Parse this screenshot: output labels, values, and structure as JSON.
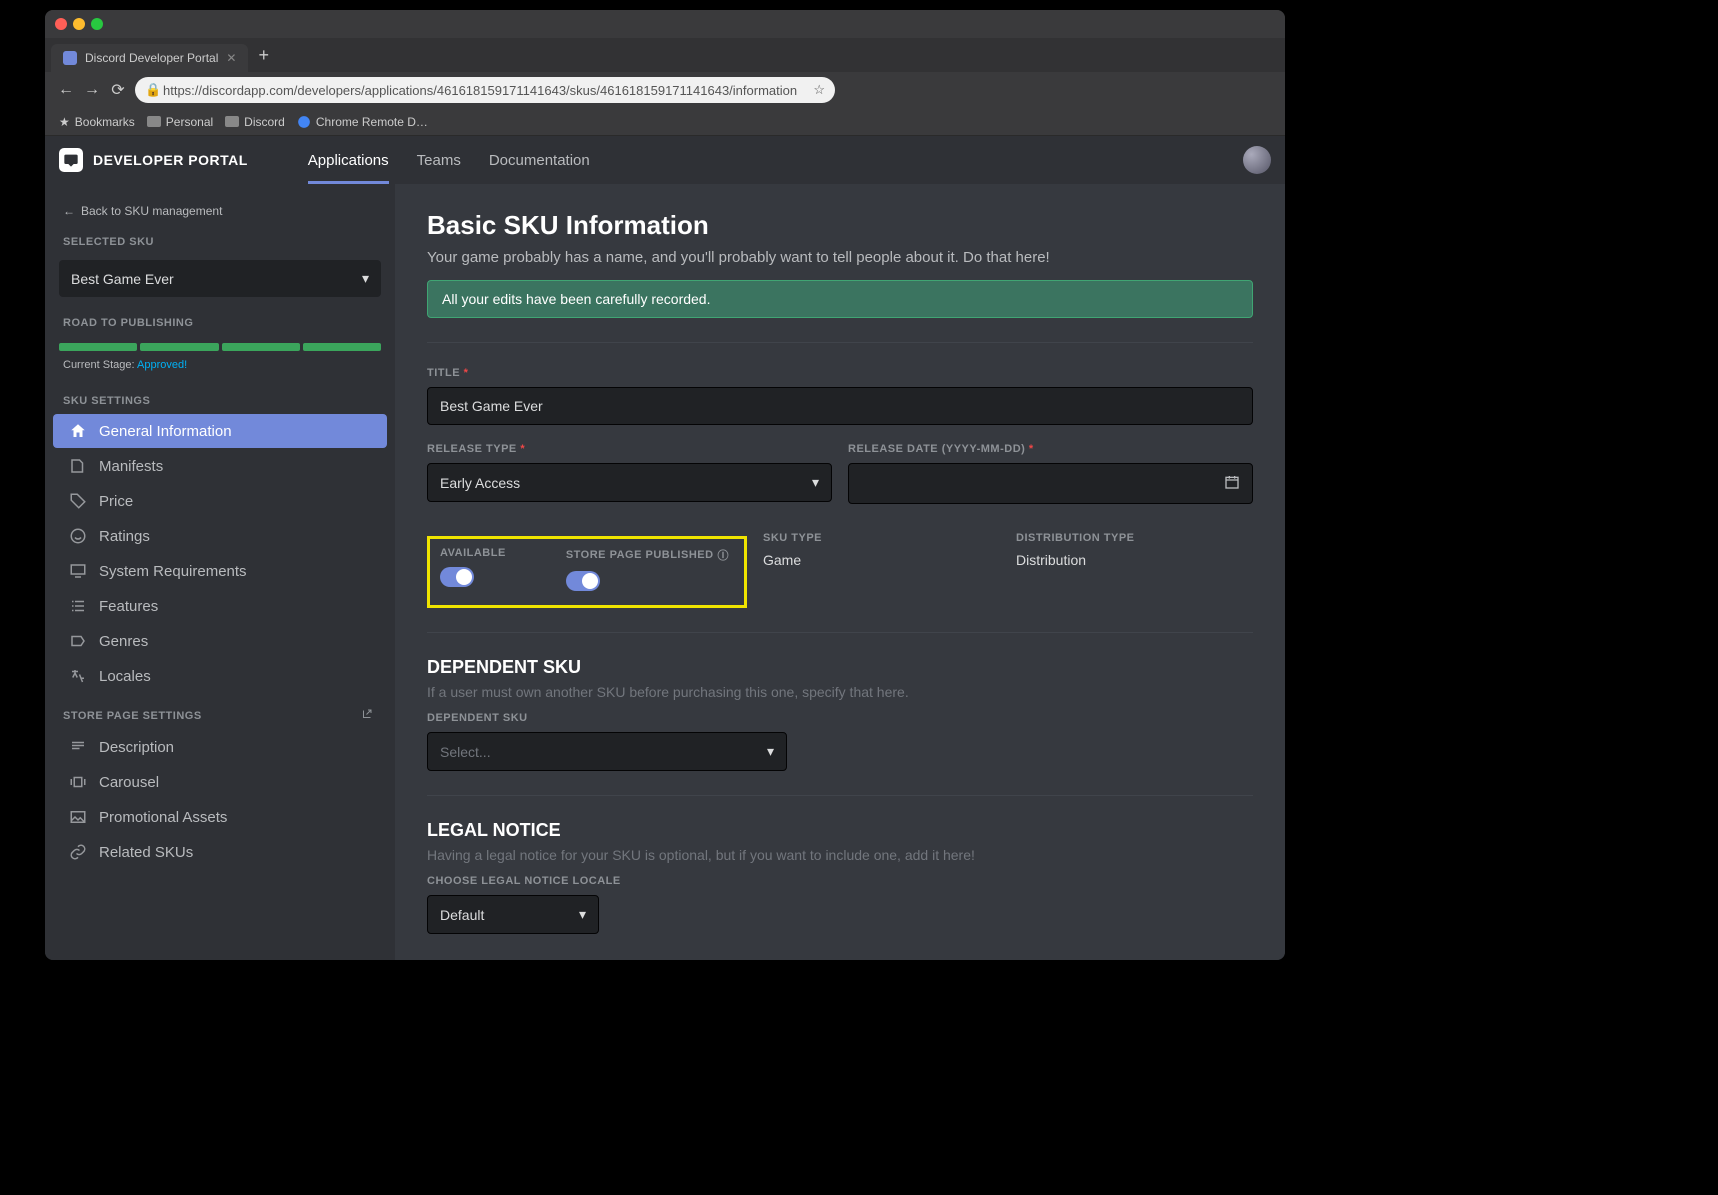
{
  "browser": {
    "tab_title": "Discord Developer Portal",
    "url": "https://discordapp.com/developers/applications/461618159171141643/skus/461618159171141643/information",
    "bookmarks": [
      "Bookmarks",
      "Personal",
      "Discord",
      "Chrome Remote D…"
    ]
  },
  "topnav": {
    "logo_text": "DEVELOPER PORTAL",
    "tabs": [
      "Applications",
      "Teams",
      "Documentation"
    ]
  },
  "sidebar": {
    "back": "Back to SKU management",
    "selected_sku_label": "SELECTED SKU",
    "selected_sku": "Best Game Ever",
    "road_label": "ROAD TO PUBLISHING",
    "stage_prefix": "Current Stage: ",
    "stage_link": "Approved!",
    "sku_settings_label": "SKU SETTINGS",
    "sku_items": [
      "General Information",
      "Manifests",
      "Price",
      "Ratings",
      "System Requirements",
      "Features",
      "Genres",
      "Locales"
    ],
    "store_settings_label": "STORE PAGE SETTINGS",
    "store_items": [
      "Description",
      "Carousel",
      "Promotional Assets",
      "Related SKUs"
    ]
  },
  "page": {
    "title": "Basic SKU Information",
    "subtitle": "Your game probably has a name, and you'll probably want to tell people about it. Do that here!",
    "banner": "All your edits have been carefully recorded.",
    "title_label": "TITLE",
    "title_value": "Best Game Ever",
    "release_type_label": "RELEASE TYPE",
    "release_type_value": "Early Access",
    "release_date_label": "RELEASE DATE (YYYY-MM-DD)",
    "available_label": "AVAILABLE",
    "published_label": "STORE PAGE PUBLISHED",
    "sku_type_label": "SKU TYPE",
    "sku_type_value": "Game",
    "dist_type_label": "DISTRIBUTION TYPE",
    "dist_type_value": "Distribution",
    "dep_heading": "DEPENDENT SKU",
    "dep_sub": "If a user must own another SKU before purchasing this one, specify that here.",
    "dep_label": "DEPENDENT SKU",
    "dep_placeholder": "Select...",
    "legal_heading": "LEGAL NOTICE",
    "legal_sub": "Having a legal notice for your SKU is optional, but if you want to include one, add it here!",
    "legal_locale_label": "CHOOSE LEGAL NOTICE LOCALE",
    "legal_locale_value": "Default"
  }
}
